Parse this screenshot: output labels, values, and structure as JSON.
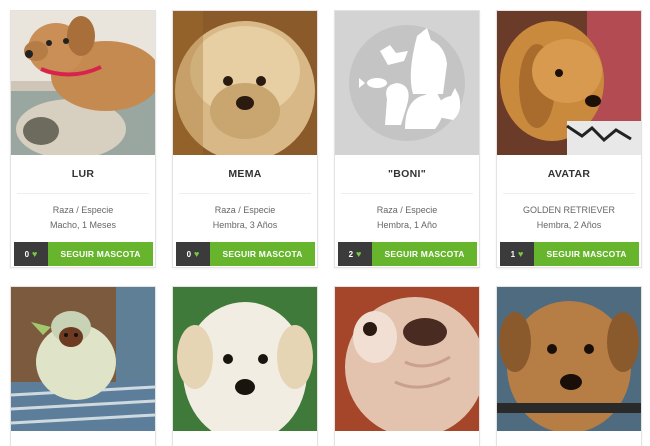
{
  "pets": [
    {
      "name": "LUR",
      "line1": "Raza / Especie",
      "line2": "Macho, 1 Meses",
      "count": "0",
      "button": "SEGUIR MASCOTA",
      "photo": "tan-dog-red-collar"
    },
    {
      "name": "MEMA",
      "line1": "Raza / Especie",
      "line2": "Hembra, 3 Años",
      "count": "0",
      "button": "SEGUIR MASCOTA",
      "photo": "fluffy-terrier"
    },
    {
      "name": "\"BONI\"",
      "line1": "Raza / Especie",
      "line2": "Hembra, 1 Año",
      "count": "2",
      "button": "SEGUIR MASCOTA",
      "photo": "placeholder-pets"
    },
    {
      "name": "AVATAR",
      "line1": "GOLDEN RETRIEVER",
      "line2": "Hembra, 2 Años",
      "count": "1",
      "button": "SEGUIR MASCOTA",
      "photo": "golden-retriever"
    }
  ],
  "row2_photos": [
    "dog-in-costume",
    "white-puppy",
    "bulldog-closeup",
    "brown-puppy"
  ],
  "icons": {
    "heart": "heart-icon",
    "placeholder": "pets-silhouette-icon"
  },
  "colors": {
    "follow_button": "#67b52d",
    "count_box": "#3b3b3b",
    "heart": "#7ac943"
  }
}
